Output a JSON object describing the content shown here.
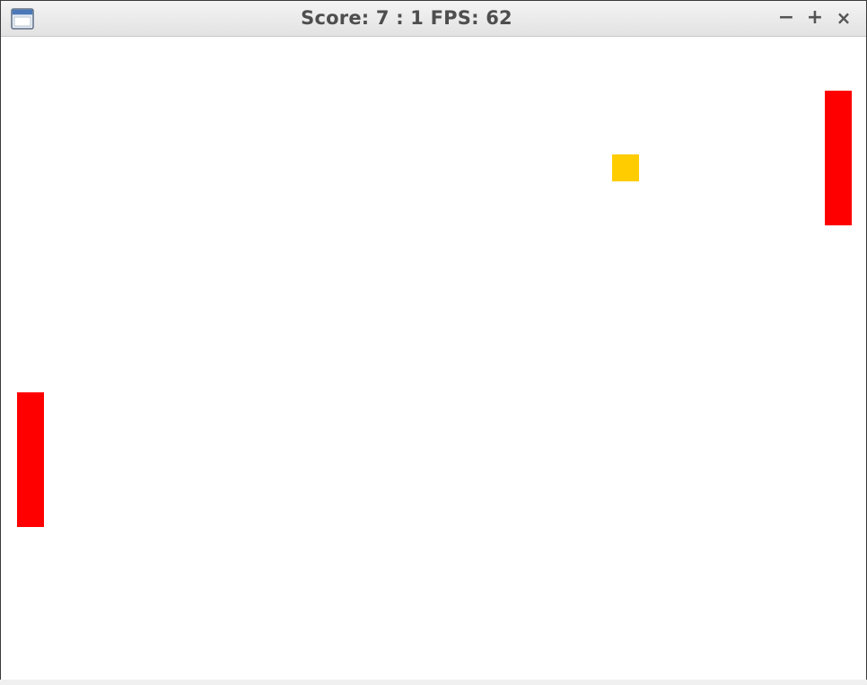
{
  "window": {
    "title": "Score: 7 : 1 FPS: 62",
    "icon": "window-app-icon",
    "controls": {
      "minimize": "−",
      "maximize": "+",
      "close": "×"
    }
  },
  "game": {
    "score_left": 7,
    "score_right": 1,
    "fps": 62,
    "background": "#ffffff",
    "paddle_color": "#ff0000",
    "ball_color": "#ffcc00"
  }
}
